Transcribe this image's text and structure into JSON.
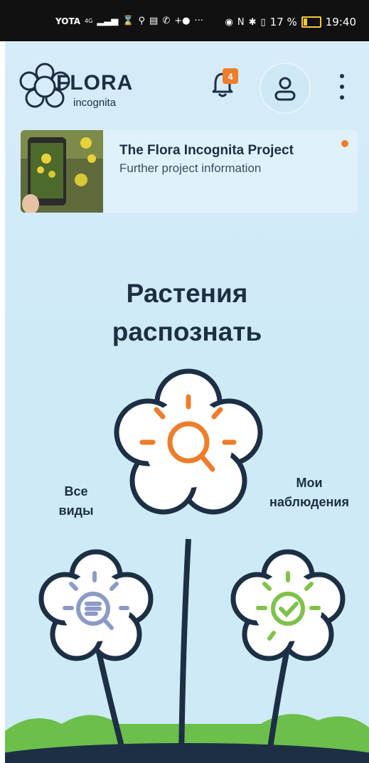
{
  "status_bar": {
    "carrier": "YOTA",
    "network": "4G",
    "battery_percent": "17 %",
    "time": "19:40"
  },
  "app": {
    "logo": {
      "brand": "FLORA",
      "sub": "incognita"
    },
    "notifications": {
      "badge_count": "4"
    },
    "icons": {
      "bell": "bell-icon",
      "profile": "user-icon",
      "menu": "more-vertical-icon",
      "identify": "magnifier-icon",
      "species": "search-list-icon",
      "observations": "checkmark-icon"
    },
    "project_card": {
      "title": "The Flora Incognita Project",
      "subtitle": "Further project information"
    },
    "headline": {
      "line1": "Растения",
      "line2": "распознать"
    },
    "labels": {
      "all_species_line1": "Все",
      "all_species_line2": "виды",
      "observations_line1": "Мои",
      "observations_line2": "наблюдения"
    }
  },
  "colors": {
    "navy": "#1c2f44",
    "orange": "#ee7d2b",
    "lavender": "#8c9ac8",
    "green": "#7fc24a",
    "background": "#d2ebf7",
    "hill": "#6cbf4a"
  }
}
